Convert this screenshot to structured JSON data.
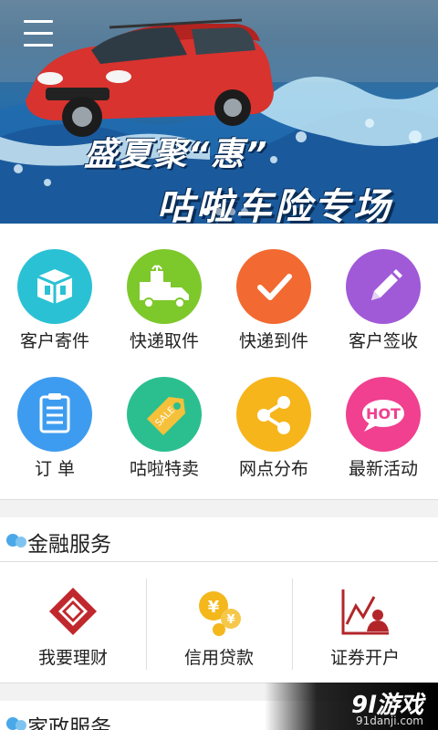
{
  "banner": {
    "line1": "盛夏聚“惠”",
    "line2": "咕啦车险专场",
    "slide_count": 4,
    "active_slide": 1
  },
  "grid": {
    "items": [
      {
        "label": "客户寄件",
        "icon": "package-icon",
        "color": "#2bc1d4"
      },
      {
        "label": "快递取件",
        "icon": "delivery-truck-icon",
        "color": "#7dc82b"
      },
      {
        "label": "快递到件",
        "icon": "checkmark-icon",
        "color": "#f26a31"
      },
      {
        "label": "客户签收",
        "icon": "pencil-icon",
        "color": "#a05ad8"
      },
      {
        "label": "订 单",
        "icon": "clipboard-icon",
        "color": "#3e9cf0"
      },
      {
        "label": "咕啦特卖",
        "icon": "sale-tag-icon",
        "color": "#2bbf8f"
      },
      {
        "label": "网点分布",
        "icon": "share-nodes-icon",
        "color": "#f6b51b"
      },
      {
        "label": "最新活动",
        "icon": "hot-bubble-icon",
        "color": "#f0408f"
      }
    ]
  },
  "finance": {
    "title": "金融服务",
    "items": [
      {
        "label": "我要理财",
        "icon": "diamond-frame-icon"
      },
      {
        "label": "信用贷款",
        "icon": "yen-coins-icon"
      },
      {
        "label": "证券开户",
        "icon": "stock-chart-person-icon"
      }
    ]
  },
  "housekeeping": {
    "title": "家政服务"
  },
  "watermark": {
    "title": "9l游戏",
    "url": "91danji.com"
  }
}
